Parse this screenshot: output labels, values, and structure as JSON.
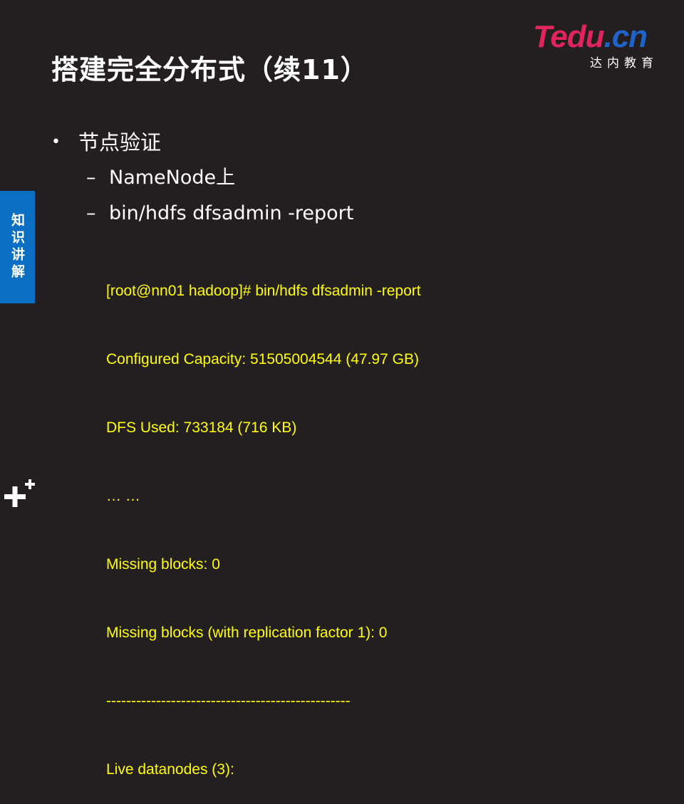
{
  "slide": {
    "title": "搭建完全分布式（续11）",
    "side_tab_label": "知识讲解"
  },
  "logo": {
    "wordmark_part1": "T",
    "wordmark_part2": "edu",
    "wordmark_part3": ".cn",
    "subtitle": "达内教育",
    "colors": {
      "red": "#e0245e",
      "blue": "#1f63c9"
    }
  },
  "content": {
    "bullet_marker": "•",
    "bullet_text": "节点验证",
    "sub_marker": "–",
    "sub_items": [
      "NameNode上",
      "bin/hdfs  dfsadmin  -report"
    ],
    "code_lines": [
      "[root@nn01 hadoop]# bin/hdfs dfsadmin -report",
      "Configured Capacity: 51505004544 (47.97 GB)",
      "DFS Used: 733184 (716 KB)",
      "… …",
      "Missing blocks: 0",
      "Missing blocks (with replication factor 1): 0",
      "-------------------------------------------------",
      "Live datanodes (3):"
    ]
  },
  "colors": {
    "background": "#231f20",
    "code_text": "#ffff00",
    "side_tab": "#0a6fc2"
  }
}
